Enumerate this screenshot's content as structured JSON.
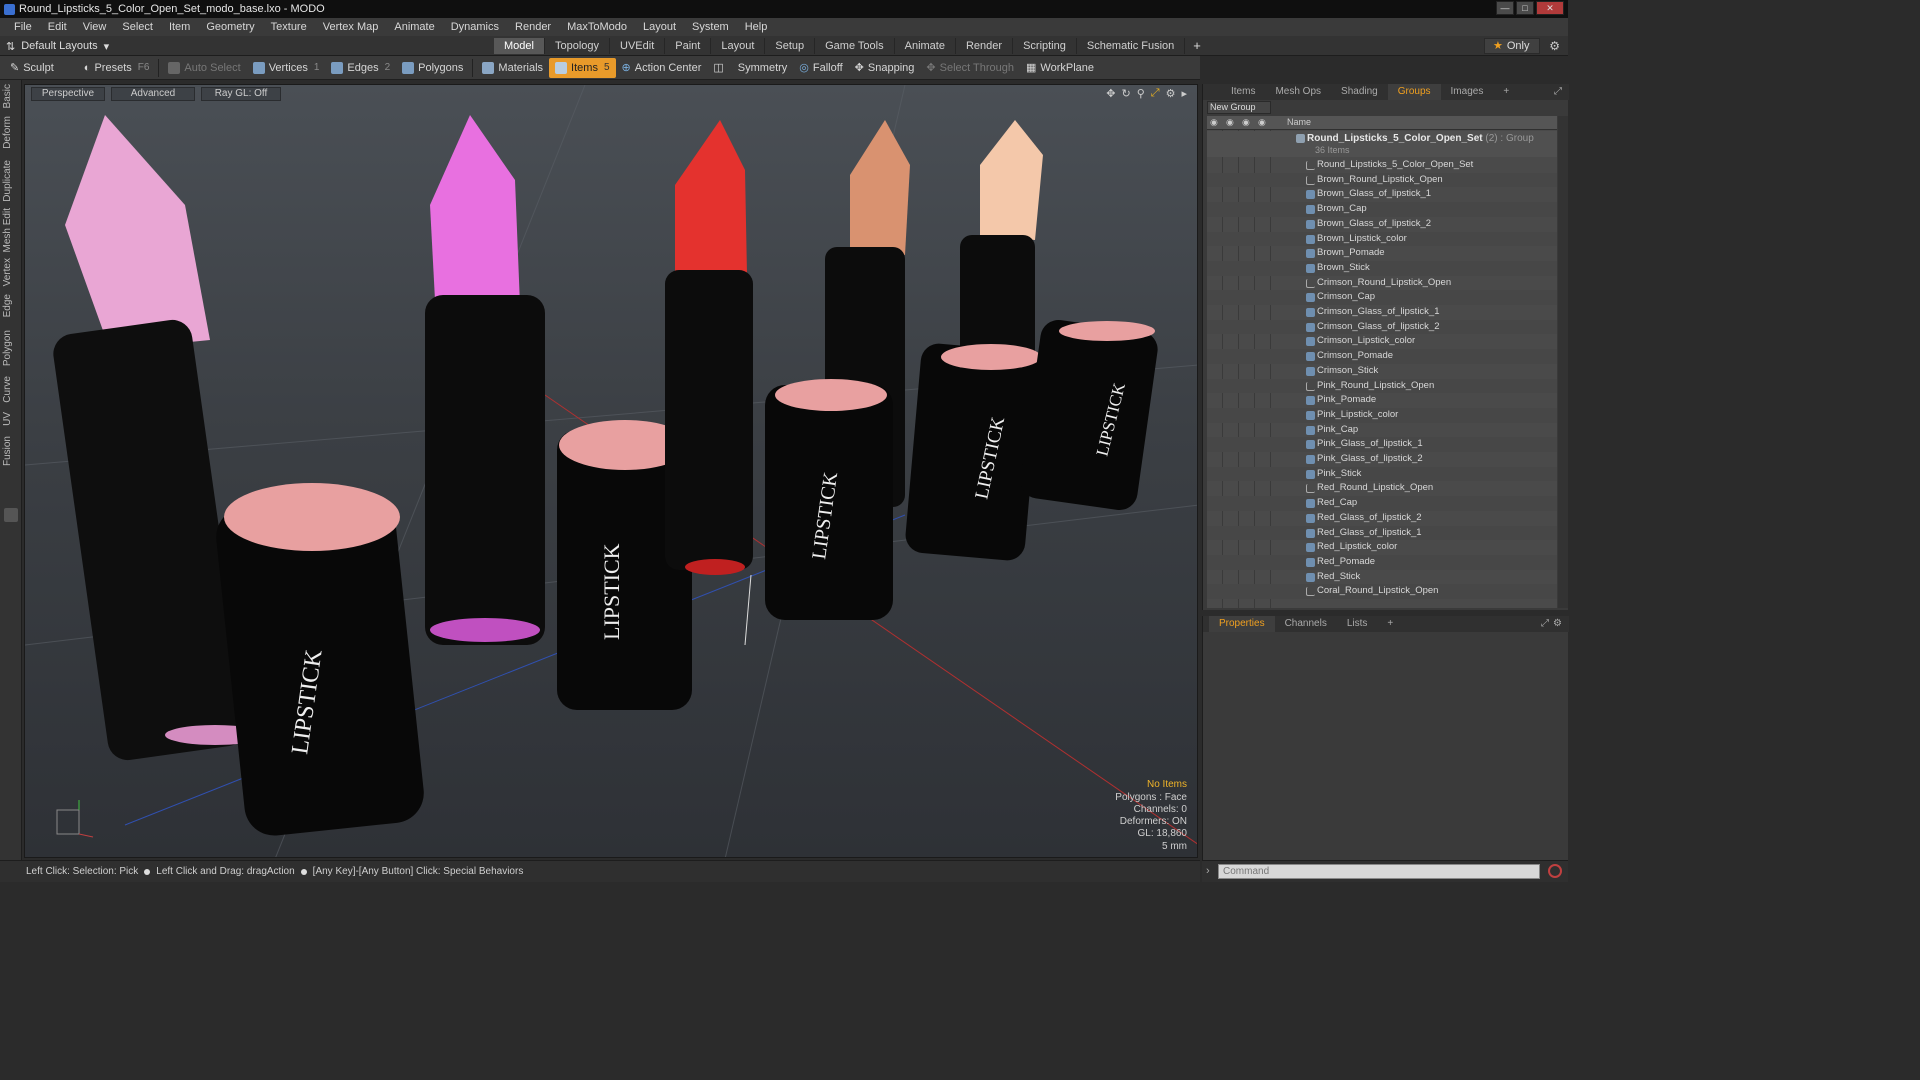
{
  "window": {
    "title": "Round_Lipsticks_5_Color_Open_Set_modo_base.lxo - MODO"
  },
  "menu": [
    "File",
    "Edit",
    "View",
    "Select",
    "Item",
    "Geometry",
    "Texture",
    "Vertex Map",
    "Animate",
    "Dynamics",
    "Render",
    "MaxToModo",
    "Layout",
    "System",
    "Help"
  ],
  "layout": {
    "dropdown": "Default Layouts",
    "tabs": [
      "Model",
      "Topology",
      "UVEdit",
      "Paint",
      "Layout",
      "Setup",
      "Game Tools",
      "Animate",
      "Render",
      "Scripting",
      "Schematic Fusion"
    ],
    "active_tab": "Model",
    "only_label": "Only"
  },
  "toolbar": {
    "sculpt": "Sculpt",
    "presets": "Presets",
    "presets_key": "F6",
    "auto_select": "Auto Select",
    "vertices": "Vertices",
    "vertices_count": "1",
    "edges": "Edges",
    "edges_count": "2",
    "polygons": "Polygons",
    "materials": "Materials",
    "items": "Items",
    "items_count": "5",
    "action_center": "Action Center",
    "symmetry": "Symmetry",
    "falloff": "Falloff",
    "snapping": "Snapping",
    "select_through": "Select Through",
    "workplane": "WorkPlane"
  },
  "left_tabs": [
    "Basic",
    "Deform",
    "Duplicate",
    "Mesh Edit",
    "Vertex",
    "Edge",
    "Polygon",
    "Curve",
    "UV",
    "Fusion"
  ],
  "viewport": {
    "view": "Perspective",
    "shading": "Advanced",
    "raygl": "Ray GL: Off",
    "label": "LIPSTICK",
    "info": {
      "no_items": "No Items",
      "polygons": "Polygons : Face",
      "channels": "Channels: 0",
      "deformers": "Deformers: ON",
      "gl": "GL: 18,860",
      "scale": "5 mm"
    },
    "lipstick_colors": [
      "#e9a6d4",
      "#e870e0",
      "#e4322e",
      "#d99270",
      "#f4c8aa"
    ]
  },
  "status": {
    "part1": "Left Click: Selection: Pick",
    "part2": "Left Click and Drag: dragAction",
    "part3": "[Any Key]-[Any Button] Click: Special Behaviors"
  },
  "groups_panel": {
    "tabs": [
      "Items",
      "Mesh Ops",
      "Shading",
      "Groups",
      "Images"
    ],
    "active_tab": "Groups",
    "new_group": "New Group",
    "column_name": "Name",
    "group": {
      "name": "Round_Lipsticks_5_Color_Open_Set",
      "count": "(2)",
      "kind": ": Group",
      "sub": "36 Items"
    },
    "items": [
      "Round_Lipsticks_5_Color_Open_Set",
      "Brown_Round_Lipstick_Open",
      "Brown_Glass_of_lipstick_1",
      "Brown_Cap",
      "Brown_Glass_of_lipstick_2",
      "Brown_Lipstick_color",
      "Brown_Pomade",
      "Brown_Stick",
      "Crimson_Round_Lipstick_Open",
      "Crimson_Cap",
      "Crimson_Glass_of_lipstick_1",
      "Crimson_Glass_of_lipstick_2",
      "Crimson_Lipstick_color",
      "Crimson_Pomade",
      "Crimson_Stick",
      "Pink_Round_Lipstick_Open",
      "Pink_Pomade",
      "Pink_Lipstick_color",
      "Pink_Cap",
      "Pink_Glass_of_lipstick_1",
      "Pink_Glass_of_lipstick_2",
      "Pink_Stick",
      "Red_Round_Lipstick_Open",
      "Red_Cap",
      "Red_Glass_of_lipstick_2",
      "Red_Glass_of_lipstick_1",
      "Red_Lipstick_color",
      "Red_Pomade",
      "Red_Stick",
      "Coral_Round_Lipstick_Open"
    ]
  },
  "properties_panel": {
    "tabs": [
      "Properties",
      "Channels",
      "Lists"
    ],
    "active_tab": "Properties"
  },
  "command": {
    "placeholder": "Command"
  }
}
